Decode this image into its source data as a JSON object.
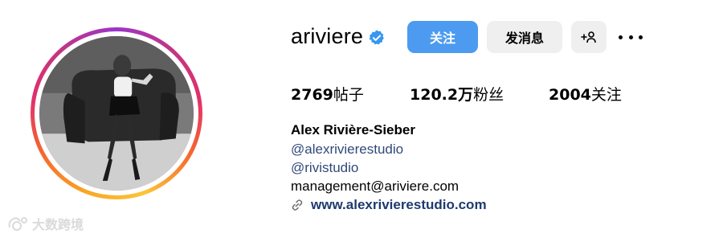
{
  "profile": {
    "username": "ariviere",
    "full_name": "Alex Rivière-Sieber",
    "verified": true
  },
  "actions": {
    "follow_label": "关注",
    "message_label": "发消息",
    "add_user_label": "+⁠👤"
  },
  "stats": {
    "posts_count": "2769",
    "posts_label": "帖子",
    "followers_count": "120.2万",
    "followers_label": "粉丝",
    "following_count": "2004",
    "following_label": "关注"
  },
  "bio": {
    "link1": "@alexrivierestudio",
    "link2": "@rivistudio",
    "email": "management@ariviere.com",
    "website": "www.alexrivierestudio.com"
  },
  "watermark": {
    "text": "大数跨境"
  },
  "colors": {
    "follow_button": "#4c9bf0",
    "secondary_button": "#efefef",
    "link": "#30497a",
    "verified": "#3897f0"
  },
  "icons": [
    "verified-badge-icon",
    "add-user-icon",
    "more-options-icon",
    "link-icon",
    "watermark-logo"
  ]
}
